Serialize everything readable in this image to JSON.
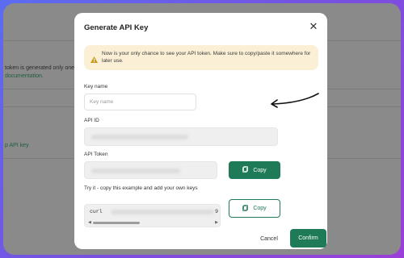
{
  "background": {
    "line1": "token is generated only one ti",
    "line2": "documentation.",
    "line3": "p API key"
  },
  "modal": {
    "title": "Generate API Key",
    "close_icon": "close-icon",
    "alert_text": "Now is your only chance to see your API token. Make sure to copy/paste it somewhere for later use.",
    "key_name_label": "Key name",
    "key_name_placeholder": "Key name",
    "key_name_value": "",
    "api_id_label": "API ID",
    "api_token_label": "API Token",
    "copy_label": "Copy",
    "example_label": "Try it - copy this example and add your own keys",
    "example_code_start": "curl",
    "example_code_end": "9",
    "copy2_label": "Copy",
    "cancel_label": "Cancel",
    "confirm_label": "Confirm"
  },
  "colors": {
    "primary": "#1f7a57",
    "alert_bg": "#fbf0d6",
    "alert_icon": "#c89a1a"
  }
}
